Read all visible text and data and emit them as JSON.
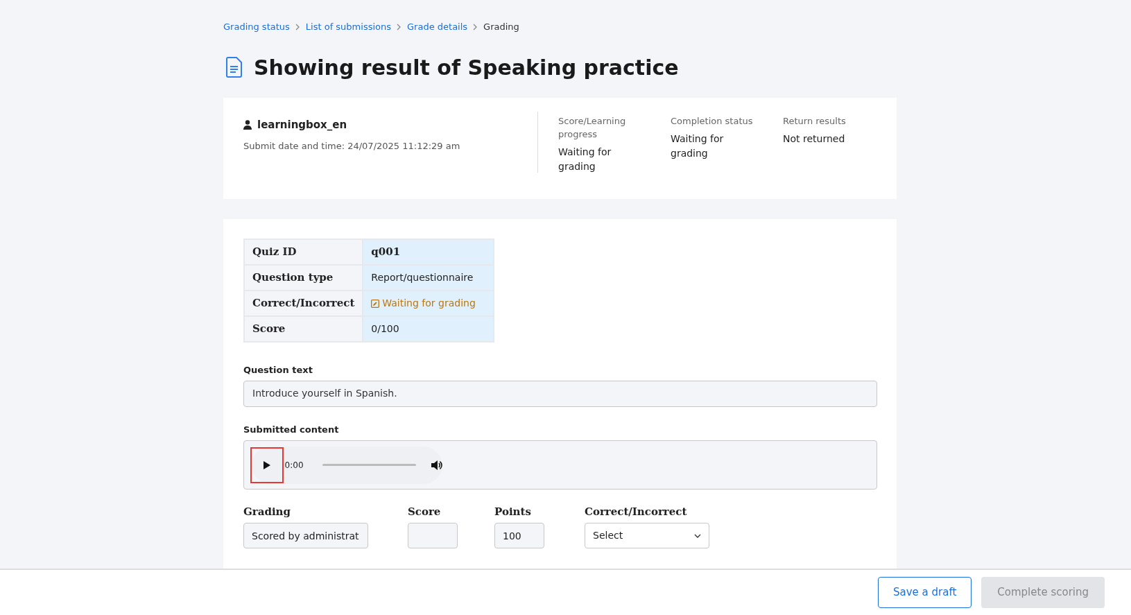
{
  "breadcrumb": [
    {
      "label": "Grading status",
      "link": true
    },
    {
      "label": "List of submissions",
      "link": true
    },
    {
      "label": "Grade details",
      "link": true
    },
    {
      "label": "Grading",
      "link": false
    }
  ],
  "title": "Showing result of Speaking practice",
  "submission": {
    "user": "learningbox_en",
    "submitted": "Submit date and time: 24/07/2025 11:12:29 am",
    "stats": [
      {
        "label": "Score/Learning progress",
        "value": "Waiting for grading"
      },
      {
        "label": "Completion status",
        "value": "Waiting for grading"
      },
      {
        "label": "Return results",
        "value": "Not returned"
      }
    ]
  },
  "quiz_table": [
    {
      "label": "Quiz ID",
      "value": "q001",
      "kind": "bold"
    },
    {
      "label": "Question type",
      "value": "Report/questionnaire",
      "kind": "plain"
    },
    {
      "label": "Correct/Incorrect",
      "value": "Waiting for grading",
      "kind": "status"
    },
    {
      "label": "Score",
      "value": "0/100",
      "kind": "plain"
    }
  ],
  "question_text": {
    "label": "Question text",
    "value": "Introduce yourself in Spanish."
  },
  "submitted_content": {
    "label": "Submitted content",
    "time": "0:00",
    "play_highlighted": true
  },
  "grading": [
    {
      "label": "Grading",
      "kind": "text",
      "value": "Scored by administrat"
    },
    {
      "label": "Score",
      "kind": "text"
    },
    {
      "label": "Points",
      "kind": "text",
      "value": "100"
    },
    {
      "label": "Correct/Incorrect",
      "kind": "select",
      "value": "Select"
    }
  ],
  "footer": [
    {
      "label": "Save a draft",
      "disabled": false
    },
    {
      "label": "Complete scoring",
      "disabled": true
    }
  ]
}
